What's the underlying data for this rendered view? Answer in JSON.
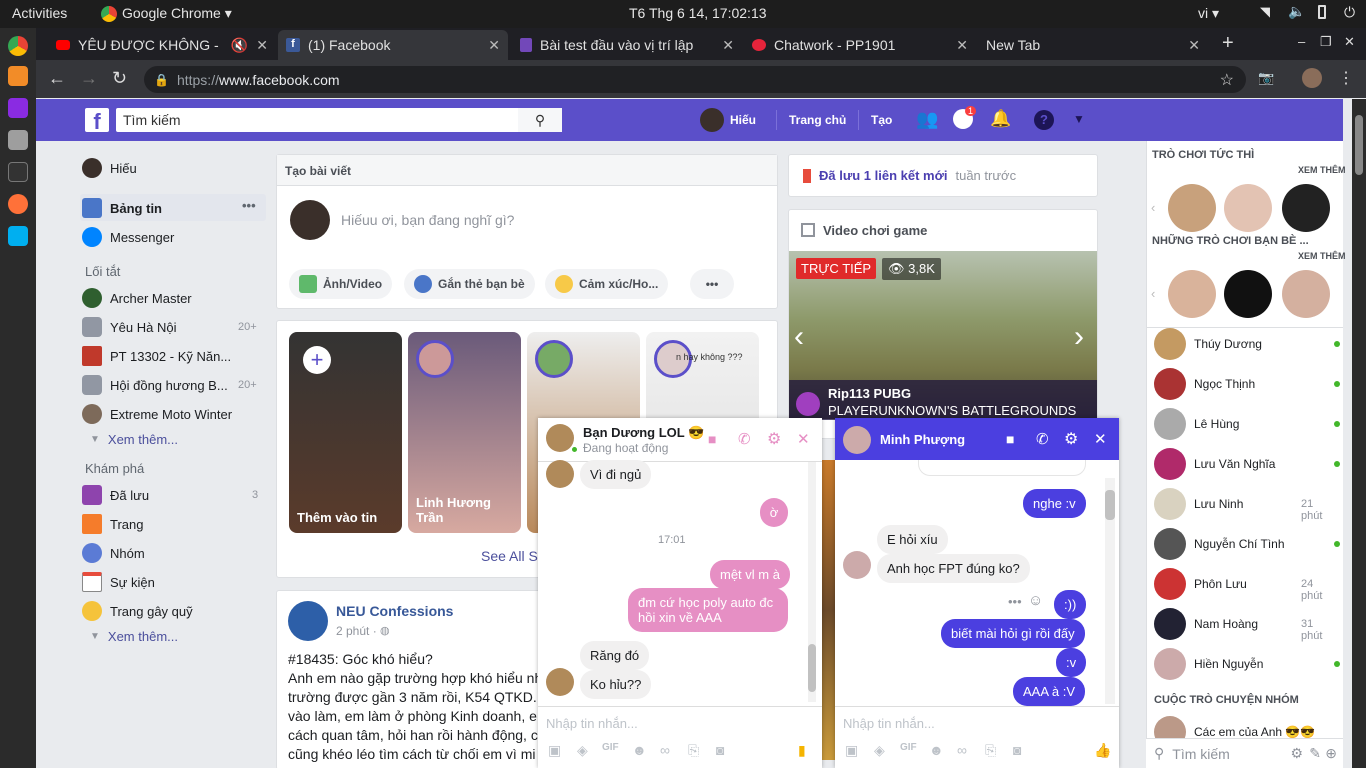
{
  "os": {
    "activities": "Activities",
    "app": "Google Chrome ▾",
    "clock": "T6 Thg 6 14, 17:02:13",
    "lang": "vi ▾"
  },
  "tabs": [
    {
      "title": "YÊU ĐƯỢC KHÔNG -",
      "active": false
    },
    {
      "title": "(1) Facebook",
      "active": true
    },
    {
      "title": "Bài test đầu vào vị trí lập",
      "active": false
    },
    {
      "title": "Chatwork - PP1901",
      "active": false
    },
    {
      "title": "New Tab",
      "active": false
    }
  ],
  "url": {
    "scheme": "https://",
    "host": "www.facebook.com"
  },
  "fb": {
    "search_placeholder": "Tìm kiếm",
    "user": "Hiếu",
    "home": "Trang chủ",
    "create": "Tạo",
    "msg_badge": "1",
    "accent": "#5b4fc9"
  },
  "left": {
    "profile": "Hiếu",
    "news": "Bảng tin",
    "messenger": "Messenger",
    "shortcuts_head": "Lối tắt",
    "shortcuts": [
      {
        "label": "Archer Master",
        "count": ""
      },
      {
        "label": "Yêu Hà Nội",
        "count": "20+"
      },
      {
        "label": "PT 13302 - Kỹ Năn...",
        "count": ""
      },
      {
        "label": "Hội đồng hương B...",
        "count": "20+"
      },
      {
        "label": "Extreme Moto Winter",
        "count": ""
      }
    ],
    "see_more": "Xem thêm...",
    "explore_head": "Khám phá",
    "explore": [
      {
        "label": "Đã lưu",
        "count": "3"
      },
      {
        "label": "Trang",
        "count": ""
      },
      {
        "label": "Nhóm",
        "count": ""
      },
      {
        "label": "Sự kiện",
        "count": ""
      },
      {
        "label": "Trang gây quỹ",
        "count": ""
      }
    ],
    "see_more2": "Xem thêm..."
  },
  "composer": {
    "title": "Tạo bài viết",
    "placeholder": "Hiếuu ơi, bạn đang nghĩ gì?",
    "photo": "Ảnh/Video",
    "tag": "Gắn thẻ bạn bè",
    "feeling": "Cảm xúc/Ho...",
    "more": "•••"
  },
  "stories": {
    "add": "Thêm vào tin",
    "s2": "Linh Hương Trần",
    "s4_caption": "n hay không ???",
    "see_all": "See All S"
  },
  "post": {
    "page": "NEU Confessions",
    "time": "2 phút ·",
    "lines": [
      "#18435: Góc khó hiểu?",
      "Anh em nào gặp trường hợp khó hiểu nh",
      "trường được gần 3 năm rồi, K54 QTKD.",
      "vào làm, em làm ở phòng Kinh doanh, e",
      "cách quan tâm, hỏi han rồi hành động, c",
      "cũng khéo léo tìm cách từ chối em vì mi"
    ]
  },
  "right": {
    "saved": "Đã lưu 1 liên kết mới",
    "saved_when": "tuần trước",
    "video_head": "Video chơi game",
    "live": "TRỰC TIẾP",
    "viewers": "3,8K",
    "streamer": "Rip113 PUBG",
    "game": "PLAYERUNKNOWN'S BATTLEGROUNDS"
  },
  "side": {
    "games_head": "TRÒ CHƠI TỨC THÌ",
    "see": "XEM THÊM",
    "friends_games": "NHỮNG TRÒ CHƠI BẠN BÈ ...",
    "see2": "XEM THÊM",
    "contacts": [
      {
        "name": "Thúy Dương",
        "time": "",
        "online": true
      },
      {
        "name": "Ngọc Thịnh",
        "time": "",
        "online": true
      },
      {
        "name": "Lê Hùng",
        "time": "",
        "online": true
      },
      {
        "name": "Lưu Văn Nghĩa",
        "time": "",
        "online": true
      },
      {
        "name": "Lưu Ninh",
        "time": "21 phút",
        "online": false
      },
      {
        "name": "Nguyễn Chí Tình",
        "time": "",
        "online": true
      },
      {
        "name": "Phôn Lưu",
        "time": "24 phút",
        "online": false
      },
      {
        "name": "Nam Hoàng",
        "time": "31 phút",
        "online": false
      },
      {
        "name": "Hiền Nguyễn",
        "time": "",
        "online": true
      }
    ],
    "groups_head": "CUỘC TRÒ CHUYỆN NHÓM",
    "group1": "Các em của Anh 😎😎",
    "search": "Tìm kiếm"
  },
  "chat1": {
    "name": "Bạn Dương LOL 😎",
    "status": "Đang hoạt động",
    "msgs": [
      "Vì đi ngủ",
      "ờ",
      "17:01",
      "mệt vl m à",
      "đm cứ học poly auto đc hồi xin về AAA",
      "Răng đó",
      "Ko hỉu??"
    ],
    "input": "Nhập tin nhắn..."
  },
  "chat2": {
    "name": "Minh Phượng",
    "msgs": [
      "nghe :v",
      "E hỏi xíu",
      "Anh học FPT đúng ko?",
      ":))",
      "biết mài hỏi gì rồi đấy",
      ":v",
      "AAA à :V"
    ],
    "input": "Nhập tin nhắn..."
  }
}
